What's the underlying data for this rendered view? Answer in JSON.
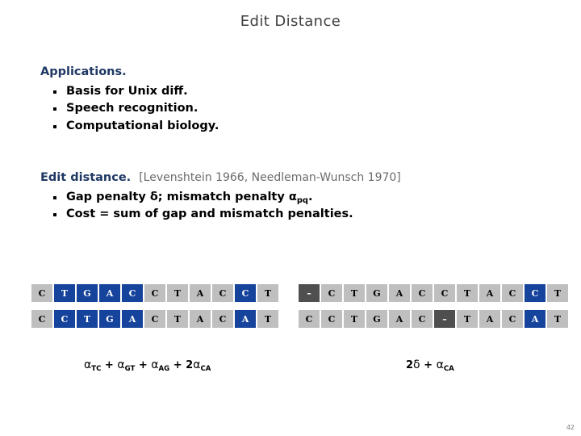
{
  "slide": {
    "title": "Edit Distance",
    "page_number": "42"
  },
  "colors": {
    "title_gray": "#3f3f3f",
    "heading_navy": "#1f3864",
    "citation_gray": "#6b6b6b",
    "cell_plain_bg": "#bfbfbf",
    "cell_highlight_bg": "#16439b",
    "cell_gap_bg": "#4f4f4f",
    "background": "#ffffff"
  },
  "applications": {
    "lead": "Applications.",
    "items": [
      "Basis for Unix diff.",
      "Speech recognition.",
      "Computational biology."
    ]
  },
  "edit_distance": {
    "lead": "Edit distance.",
    "citation": "[Levenshtein 1966, Needleman-Wunsch 1970]",
    "items": [
      {
        "prefix": "Gap penalty δ; mismatch penalty α",
        "subscript": "pq",
        "suffix": "."
      },
      {
        "prefix": "Cost = sum of gap and mismatch penalties.",
        "subscript": "",
        "suffix": ""
      }
    ]
  },
  "alignments": [
    {
      "name": "alignment-without-gaps",
      "rows": [
        [
          {
            "letter": "C",
            "state": "plain"
          },
          {
            "letter": "T",
            "state": "highlight"
          },
          {
            "letter": "G",
            "state": "highlight"
          },
          {
            "letter": "A",
            "state": "highlight"
          },
          {
            "letter": "C",
            "state": "highlight"
          },
          {
            "letter": "C",
            "state": "plain"
          },
          {
            "letter": "T",
            "state": "plain"
          },
          {
            "letter": "A",
            "state": "plain"
          },
          {
            "letter": "C",
            "state": "plain"
          },
          {
            "letter": "C",
            "state": "highlight"
          },
          {
            "letter": "T",
            "state": "plain"
          }
        ],
        [
          {
            "letter": "C",
            "state": "plain"
          },
          {
            "letter": "C",
            "state": "highlight"
          },
          {
            "letter": "T",
            "state": "highlight"
          },
          {
            "letter": "G",
            "state": "highlight"
          },
          {
            "letter": "A",
            "state": "highlight"
          },
          {
            "letter": "C",
            "state": "plain"
          },
          {
            "letter": "T",
            "state": "plain"
          },
          {
            "letter": "A",
            "state": "plain"
          },
          {
            "letter": "C",
            "state": "plain"
          },
          {
            "letter": "A",
            "state": "highlight"
          },
          {
            "letter": "T",
            "state": "plain"
          }
        ]
      ],
      "cost": {
        "terms": [
          {
            "symbol": "α",
            "subscript": "TC",
            "coefficient": ""
          },
          {
            "symbol": "α",
            "subscript": "GT",
            "coefficient": ""
          },
          {
            "symbol": "α",
            "subscript": "AG",
            "coefficient": ""
          },
          {
            "symbol": "α",
            "subscript": "CA",
            "coefficient": "2"
          }
        ]
      }
    },
    {
      "name": "alignment-with-gaps",
      "rows": [
        [
          {
            "letter": "–",
            "state": "gap"
          },
          {
            "letter": "C",
            "state": "plain"
          },
          {
            "letter": "T",
            "state": "plain"
          },
          {
            "letter": "G",
            "state": "plain"
          },
          {
            "letter": "A",
            "state": "plain"
          },
          {
            "letter": "C",
            "state": "plain"
          },
          {
            "letter": "C",
            "state": "plain"
          },
          {
            "letter": "T",
            "state": "plain"
          },
          {
            "letter": "A",
            "state": "plain"
          },
          {
            "letter": "C",
            "state": "plain"
          },
          {
            "letter": "C",
            "state": "highlight"
          },
          {
            "letter": "T",
            "state": "plain"
          }
        ],
        [
          {
            "letter": "C",
            "state": "plain"
          },
          {
            "letter": "C",
            "state": "plain"
          },
          {
            "letter": "T",
            "state": "plain"
          },
          {
            "letter": "G",
            "state": "plain"
          },
          {
            "letter": "A",
            "state": "plain"
          },
          {
            "letter": "C",
            "state": "plain"
          },
          {
            "letter": "–",
            "state": "gap"
          },
          {
            "letter": "T",
            "state": "plain"
          },
          {
            "letter": "A",
            "state": "plain"
          },
          {
            "letter": "C",
            "state": "plain"
          },
          {
            "letter": "A",
            "state": "highlight"
          },
          {
            "letter": "T",
            "state": "plain"
          }
        ]
      ],
      "cost": {
        "terms": [
          {
            "symbol": "δ",
            "subscript": "",
            "coefficient": "2"
          },
          {
            "symbol": "α",
            "subscript": "CA",
            "coefficient": ""
          }
        ]
      }
    }
  ]
}
